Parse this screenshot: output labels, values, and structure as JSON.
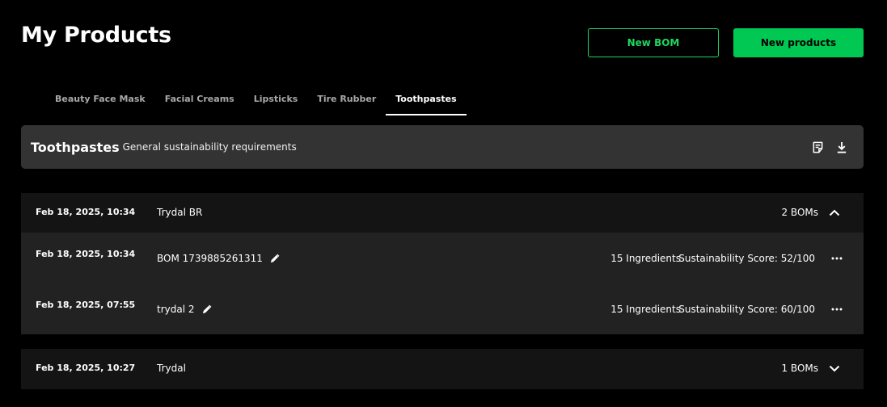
{
  "page": {
    "title": "My Products"
  },
  "actions": {
    "new_bom_label": "New BOM",
    "new_products_label": "New products"
  },
  "tabs": [
    {
      "label": "Beauty Face Mask",
      "active": false
    },
    {
      "label": "Facial Creams",
      "active": false
    },
    {
      "label": "Lipsticks",
      "active": false
    },
    {
      "label": "Tire Rubber",
      "active": false
    },
    {
      "label": "Toothpastes",
      "active": true
    }
  ],
  "requirements": {
    "title": "Toothpastes",
    "subtitle": "General sustainability requirements",
    "icons": [
      "notes-icon",
      "download-icon"
    ]
  },
  "groups": [
    {
      "date": "Feb 18, 2025, 10:34",
      "name": "Trydal BR",
      "count": "2 BOMs",
      "expanded": true,
      "boms": [
        {
          "date": "Feb 18, 2025, 10:34",
          "name": "BOM 1739885261311",
          "ingredients": "15 Ingredients",
          "score": "Sustainability Score: 52/100"
        },
        {
          "date": "Feb 18, 2025, 07:55",
          "name": "trydal 2",
          "ingredients": "15 Ingredients",
          "score": "Sustainability Score: 60/100"
        }
      ]
    },
    {
      "date": "Feb 18, 2025, 10:27",
      "name": "Trydal",
      "count": "1 BOMs",
      "expanded": false,
      "boms": []
    }
  ],
  "colors": {
    "accent": "#00c853",
    "accent_outline": "#1ed760",
    "background": "#000000",
    "panel": "#333333",
    "row_header": "#141414",
    "row_body": "#222222"
  }
}
